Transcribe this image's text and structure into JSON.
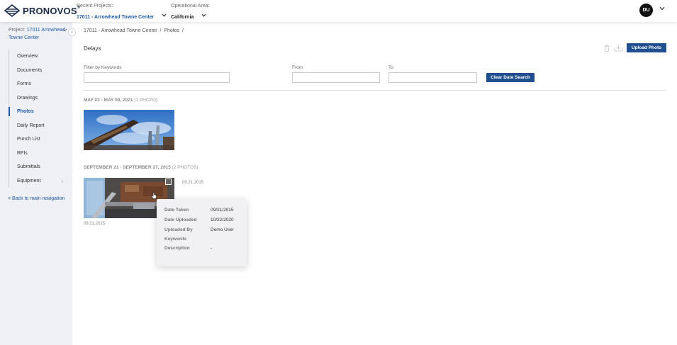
{
  "header": {
    "logo_text": "PRONOVOS",
    "logo_mark": "®",
    "recent_label": "Recent Projects:",
    "recent_value": "17011 - Arrowhead Towne Center",
    "area_label": "Operational Area:",
    "area_value": "California",
    "avatar_initials": "DU"
  },
  "sidebar": {
    "project_prefix": "Project:",
    "project_name": "17011 Arrowhead Towne Center",
    "items": [
      {
        "label": "Overview"
      },
      {
        "label": "Documents"
      },
      {
        "label": "Forms"
      },
      {
        "label": "Drawings"
      },
      {
        "label": "Photos",
        "active": true
      },
      {
        "label": "Daily Report"
      },
      {
        "label": "Punch List"
      },
      {
        "label": "RFIs"
      },
      {
        "label": "Submittals"
      },
      {
        "label": "Equipment",
        "has_children": true
      }
    ],
    "back_link": "< Back to main navigation"
  },
  "main": {
    "breadcrumb": "17011 - Arrowhead Towne Center  /  Photos  /",
    "title": "Delays",
    "upload_button": "Upload Photo",
    "filter": {
      "keywords_label": "Filter by Keywords",
      "keywords_value": "",
      "from_label": "From",
      "from_value": "",
      "to_label": "To",
      "to_value": "",
      "clear_button": "Clear Date Search"
    },
    "groups": [
      {
        "range": "MAY 03 - MAY 09, 2021",
        "count": "(1 PHOTO)"
      },
      {
        "range": "SEPTEMBER 21 - SEPTEMBER 27, 2015",
        "count": "(2 PHOTOS)",
        "photo_dates": [
          "09.21.2015",
          "09.21.2015"
        ]
      }
    ],
    "popup": {
      "rows": [
        {
          "label": "Date Taken",
          "value": "09/21/2015"
        },
        {
          "label": "Date Uploaded",
          "value": "10/22/2020"
        },
        {
          "label": "Uploaded By",
          "value": "Demo User"
        },
        {
          "label": "Keywords",
          "value": ""
        },
        {
          "label": "Description",
          "value": "-"
        }
      ]
    }
  },
  "colors": {
    "accent": "#1f5aa6",
    "button": "#1f4f8f",
    "sidebar_bg": "#eef0f6"
  }
}
